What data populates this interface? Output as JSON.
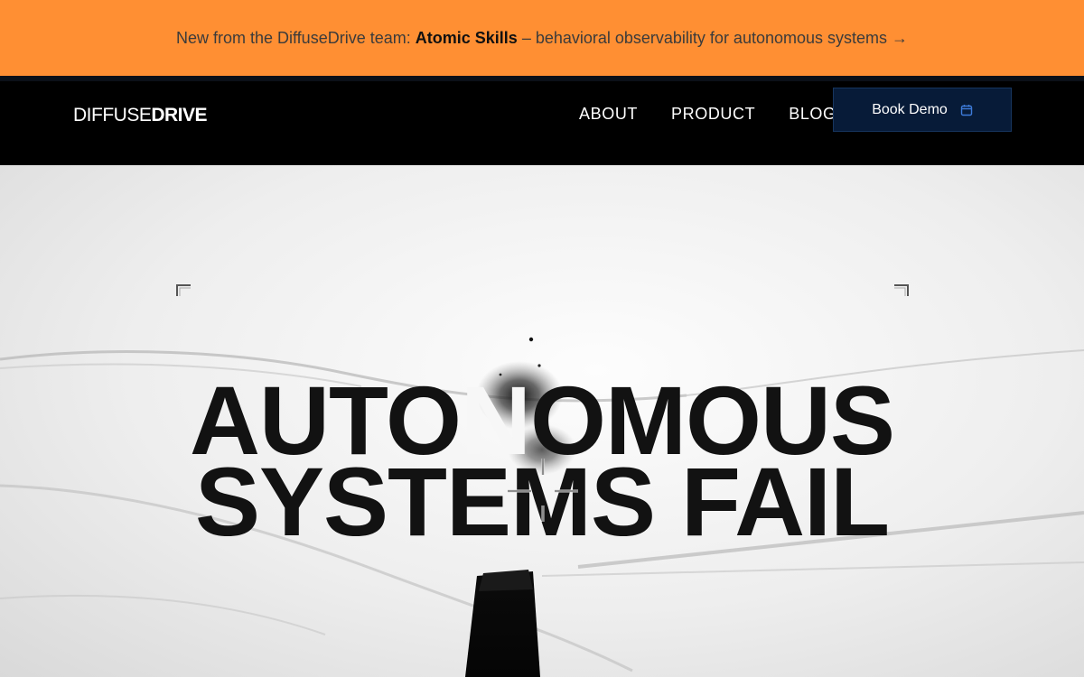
{
  "banner": {
    "prefix": "New from the DiffuseDrive team:",
    "highlight": "Atomic Skills",
    "suffix": "– behavioral observability for autonomous systems →",
    "color": "#ff8f33"
  },
  "nav": {
    "logo_light": "DIFFUSE",
    "logo_bold": "DRIVE",
    "links": [
      {
        "label": "ABOUT"
      },
      {
        "label": "PRODUCT"
      },
      {
        "label": "BLOG"
      }
    ],
    "cta_label": "Book Demo",
    "cta_icon": "calendar-icon",
    "cta_color": "#071b38"
  },
  "hero": {
    "headline_line1_a": "AUTO",
    "headline_line1_b": "N",
    "headline_line1_c": "OMOUS",
    "headline_line2": "SYSTEMS FAIL"
  }
}
